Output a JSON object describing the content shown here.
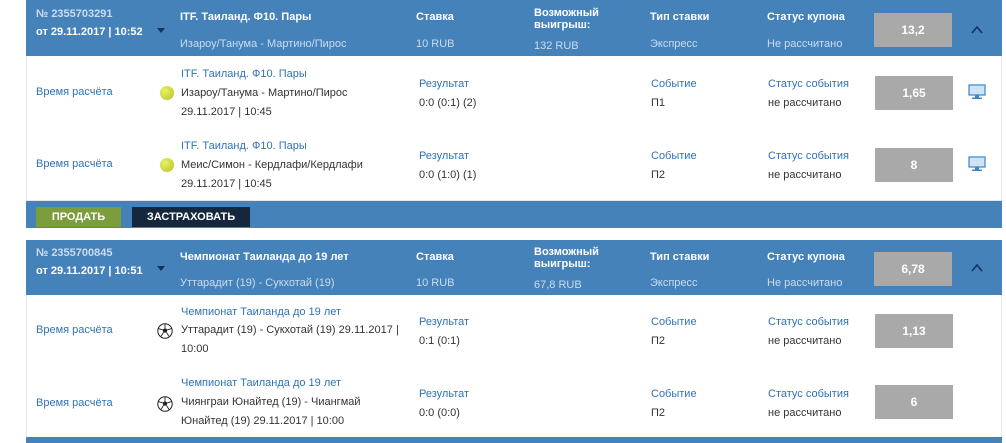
{
  "coupons": [
    {
      "id": "№ 2355703291",
      "date": "от 29.11.2017 | 10:52",
      "title": "ITF. Таиланд. Ф10. Пары",
      "subtitle": "Изароу/Танума - Мартино/Пирос",
      "stake_label": "Ставка",
      "stake_value": "10 RUB",
      "win_label": "Возможный выигрыш:",
      "win_value": "132 RUB",
      "type_label": "Тип ставки",
      "type_value": "Экспресс",
      "status_label": "Статус купона",
      "status_value": "Не рассчитано",
      "coef": "13,2",
      "events": [
        {
          "calc_label": "Время расчёта",
          "sport_icon": "tennis-ball-icon",
          "league": "ITF. Таиланд. Ф10. Пары",
          "match": "Изароу/Танума - Мартино/Пирос",
          "datetime": "29.11.2017 | 10:45",
          "result_label": "Результат",
          "result_value": "0:0 (0:1) (2)",
          "event_label": "Событие",
          "event_value": "П1",
          "status_label": "Статус события",
          "status_value": "не рассчитано",
          "coef": "1,65"
        },
        {
          "calc_label": "Время расчёта",
          "sport_icon": "tennis-ball-icon",
          "league": "ITF. Таиланд. Ф10. Пары",
          "match": "Меис/Симон - Кердлафи/Кердлафи",
          "datetime": "29.11.2017 | 10:45",
          "result_label": "Результат",
          "result_value": "0:0 (1:0) (1)",
          "event_label": "Событие",
          "event_value": "П2",
          "status_label": "Статус события",
          "status_value": "не рассчитано",
          "coef": "8"
        }
      ],
      "sell_button": "ПРОДАТЬ",
      "insure_button": "ЗАСТРАХОВАТЬ"
    },
    {
      "id": "№ 2355700845",
      "date": "от 29.11.2017 | 10:51",
      "title": "Чемпионат Таиланда до 19 лет",
      "subtitle": "Уттарадит (19) - Сукхотай (19)",
      "stake_label": "Ставка",
      "stake_value": "10 RUB",
      "win_label": "Возможный выигрыш:",
      "win_value": "67,8 RUB",
      "type_label": "Тип ставки",
      "type_value": "Экспресс",
      "status_label": "Статус купона",
      "status_value": "Не рассчитано",
      "coef": "6,78",
      "events": [
        {
          "calc_label": "Время расчёта",
          "sport_icon": "soccer-ball-icon",
          "league": "Чемпионат Таиланда до 19 лет",
          "match": "Уттарадит (19) - Сукхотай (19) 29.11.2017 | 10:00",
          "result_label": "Результат",
          "result_value": "0:1 (0:1)",
          "event_label": "Событие",
          "event_value": "П2",
          "status_label": "Статус события",
          "status_value": "не рассчитано",
          "coef": "1,13"
        },
        {
          "calc_label": "Время расчёта",
          "sport_icon": "soccer-ball-icon",
          "league": "Чемпионат Таиланда до 19 лет",
          "match": "Чиянграи Юнайтед (19) - Чиангмай Юнайтед (19) 29.11.2017 | 10:00",
          "result_label": "Результат",
          "result_value": "0:0 (0:0)",
          "event_label": "Событие",
          "event_value": "П2",
          "status_label": "Статус события",
          "status_value": "не рассчитано",
          "coef": "6"
        }
      ]
    }
  ],
  "colors": {
    "header_bg": "#4682ba",
    "link_blue": "#2f73b5",
    "coef_bg": "#a9a9a9",
    "sell_green": "#7b9d3c",
    "insure_dark": "#15273d"
  }
}
